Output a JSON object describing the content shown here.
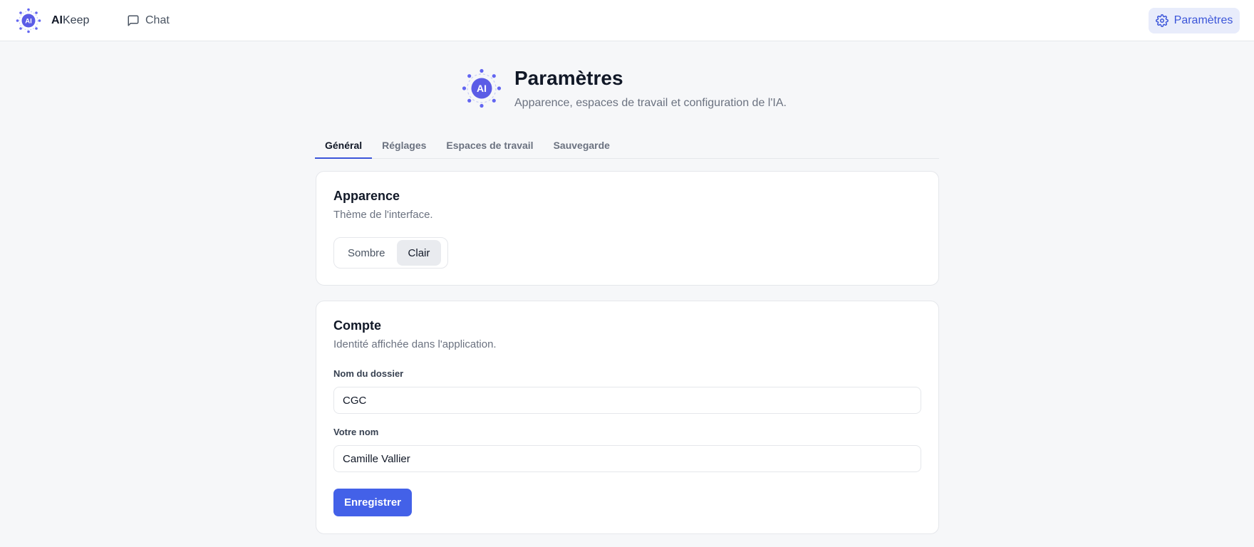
{
  "app": {
    "brand_bold": "AI",
    "brand_rest": "Keep",
    "logo_text": "AI",
    "accent": "#4361e8"
  },
  "nav": {
    "chat_label": "Chat",
    "settings_label": "Paramètres"
  },
  "page": {
    "title": "Paramètres",
    "subtitle": "Apparence, espaces de travail et configuration de l'IA."
  },
  "tabs": [
    {
      "label": "Général",
      "active": true
    },
    {
      "label": "Réglages",
      "active": false
    },
    {
      "label": "Espaces de travail",
      "active": false
    },
    {
      "label": "Sauvegarde",
      "active": false
    }
  ],
  "appearance": {
    "title": "Apparence",
    "description": "Thème de l'interface.",
    "options": [
      "Sombre",
      "Clair"
    ],
    "selected": "Clair"
  },
  "account": {
    "title": "Compte",
    "description": "Identité affichée dans l'application.",
    "folder_label": "Nom du dossier",
    "folder_value": "CGC",
    "name_label": "Votre nom",
    "name_value": "Camille Vallier",
    "save_label": "Enregistrer"
  },
  "icons": {
    "chat": "chat-bubble-icon",
    "settings": "gear-icon"
  }
}
